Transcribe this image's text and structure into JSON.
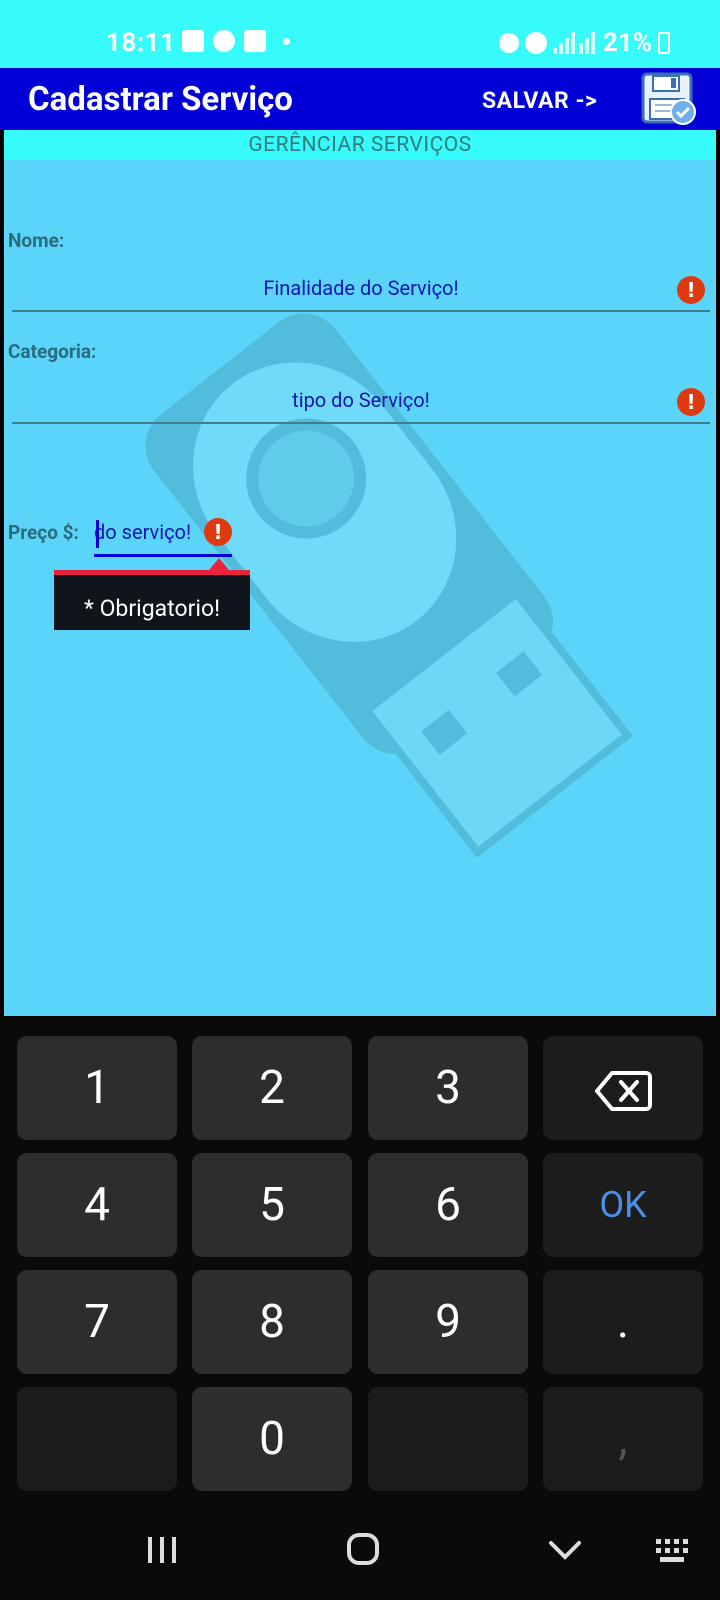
{
  "status_bar": {
    "time": "18:11",
    "battery": "21%"
  },
  "app_bar": {
    "title": "Cadastrar Serviço",
    "save_label": "SALVAR ->",
    "save_icon": "floppy-disk-check-icon"
  },
  "form": {
    "section_title": "GERÊNCIAR SERVIÇOS",
    "name_label": "Nome:",
    "name_placeholder": "Finalidade do Serviço!",
    "category_label": "Categoria:",
    "category_placeholder": "tipo do Serviço!",
    "price_label": "Preço $:",
    "price_placeholder": "do serviço!",
    "error_message": "* Obrigatorio!"
  },
  "keyboard": {
    "keys": [
      "1",
      "2",
      "3",
      "4",
      "5",
      "6",
      "7",
      "8",
      "9",
      "0"
    ],
    "ok_label": "OK",
    "period_label": ".",
    "comma_label": ","
  },
  "colors": {
    "status_bar": "#37fbfb",
    "app_bar": "#0000d6",
    "content_bg": "#5ad4f8",
    "error": "#dd3a12",
    "ok_key": "#4c8fe6"
  }
}
